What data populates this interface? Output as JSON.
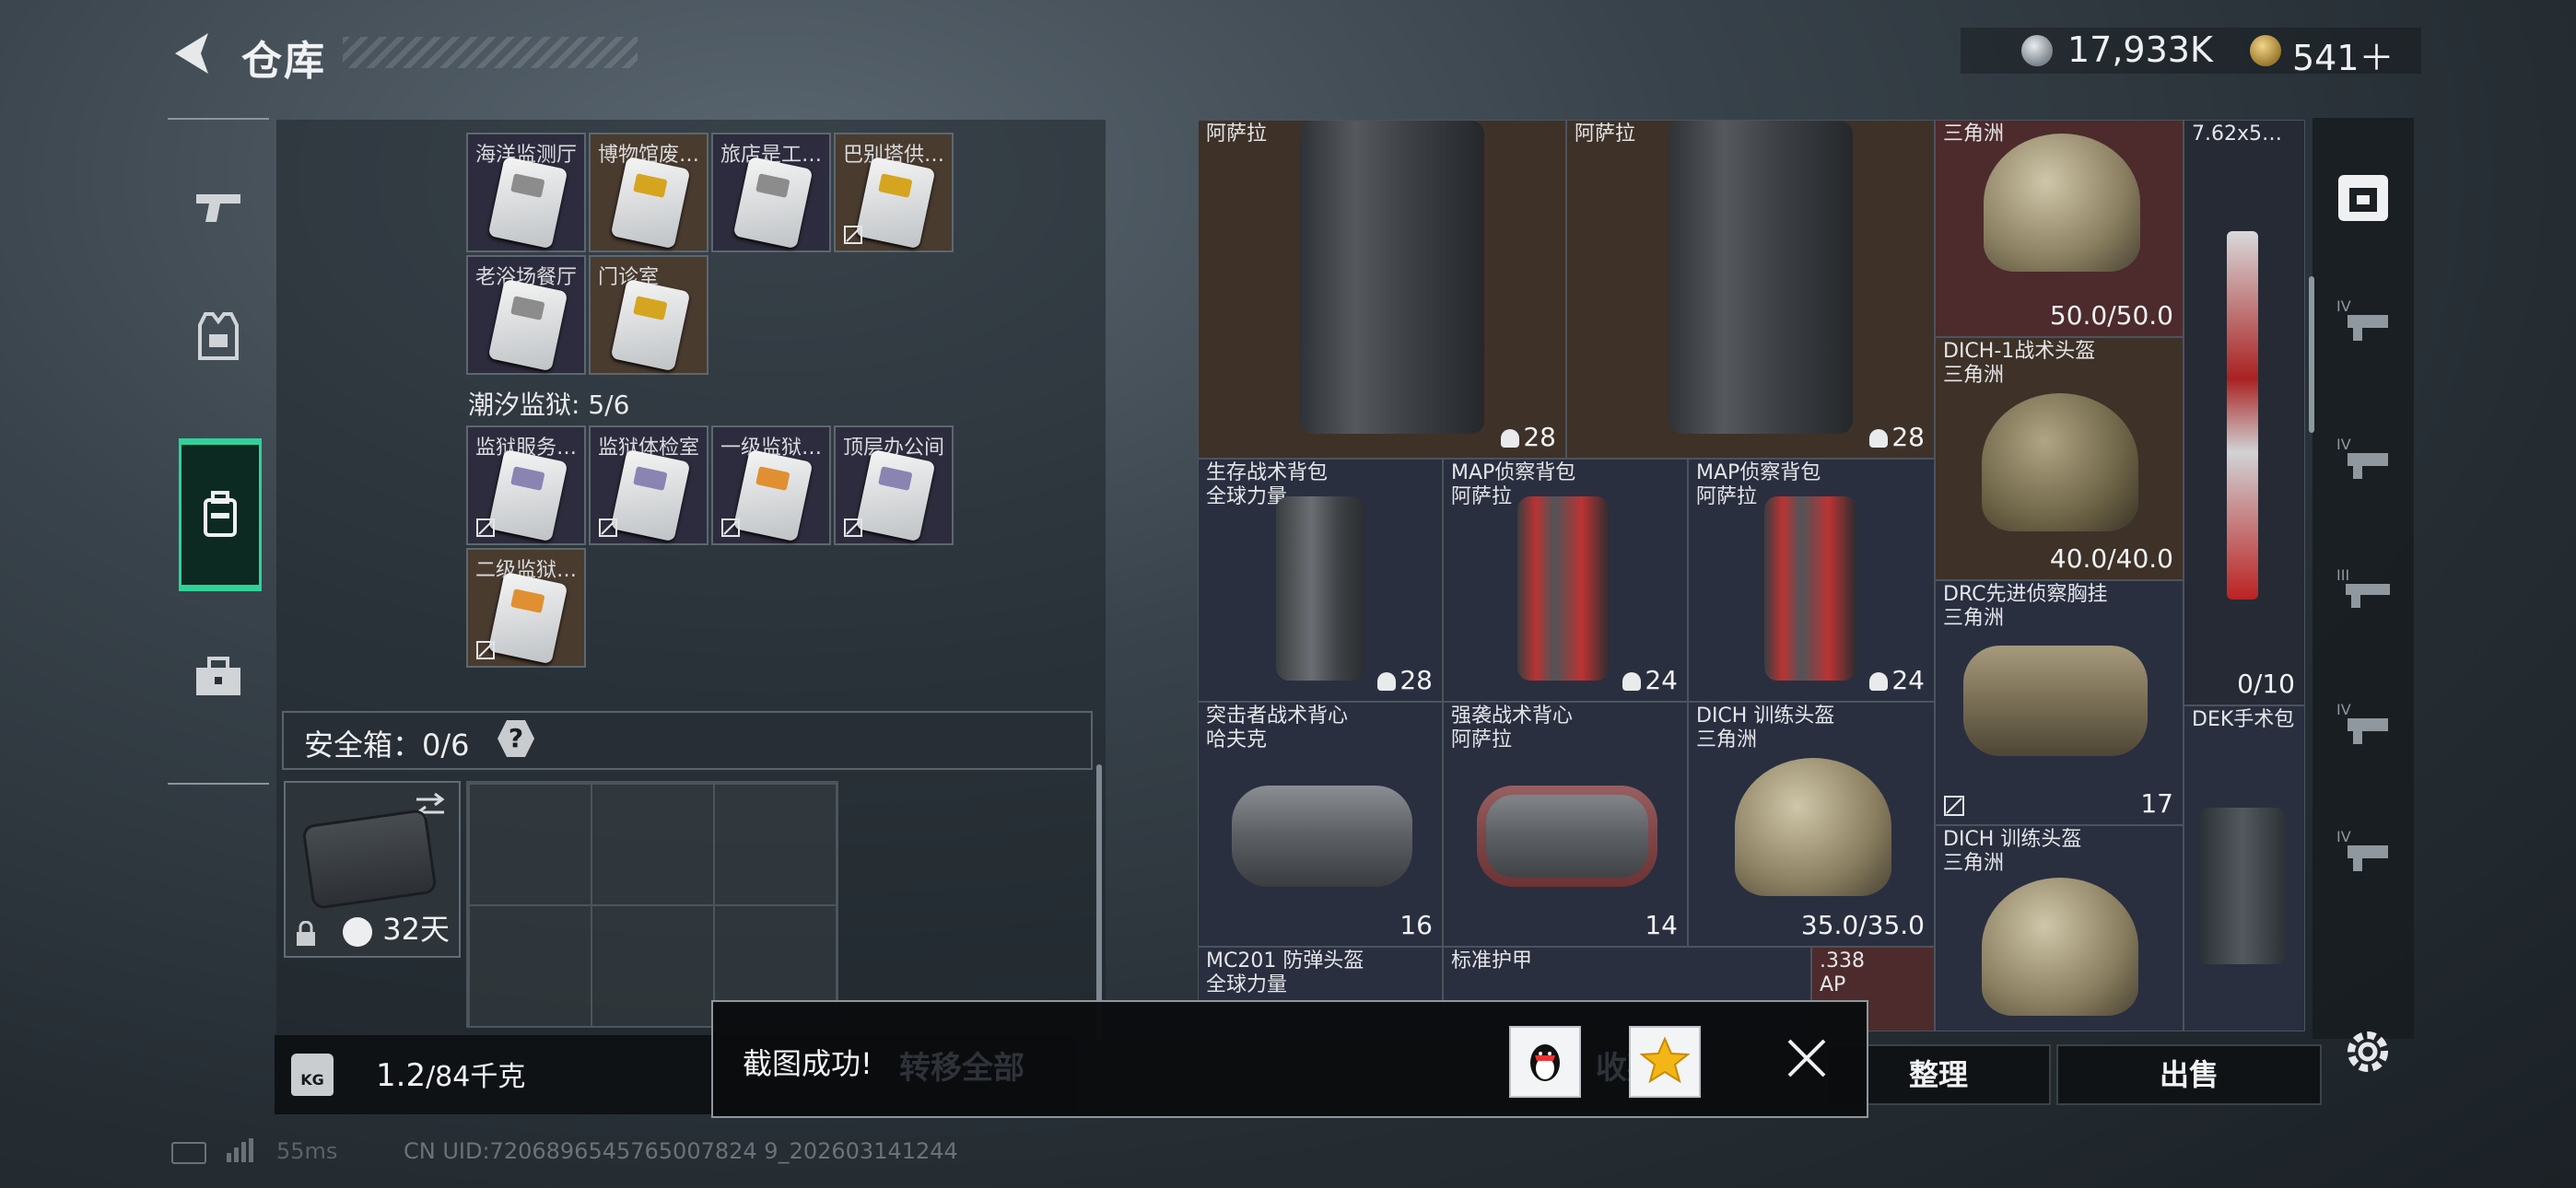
{
  "header": {
    "title": "仓库",
    "silver": "17,933K",
    "gold": "541＋"
  },
  "left_nav": [
    {
      "icon": "pistol-icon"
    },
    {
      "icon": "vest-icon"
    },
    {
      "icon": "backpack-icon"
    },
    {
      "icon": "toolbox-icon"
    }
  ],
  "keycards_top": [
    {
      "label": "海洋监测厅",
      "card": "kc-plain",
      "locked": false,
      "tone": "violet"
    },
    {
      "label": "博物馆废…",
      "card": "kc-gold",
      "locked": false,
      "tone": "orange"
    },
    {
      "label": "旅店是工…",
      "card": "kc-plain",
      "locked": false,
      "tone": "violet"
    },
    {
      "label": "巴别塔供…",
      "card": "kc-gold",
      "locked": true,
      "tone": "orange"
    },
    {
      "label": "老浴场餐厅",
      "card": "kc-plain",
      "locked": false,
      "tone": "violet"
    },
    {
      "label": "门诊室",
      "card": "kc-gold",
      "locked": false,
      "tone": "orange"
    }
  ],
  "tidal": {
    "label": "潮汐监狱: 5/6"
  },
  "keycards_tidal": [
    {
      "label": "监狱服务…",
      "card": "kc-violet",
      "locked": true,
      "tone": "violet"
    },
    {
      "label": "监狱体检室",
      "card": "kc-violet",
      "locked": true,
      "tone": "violet"
    },
    {
      "label": "一级监狱…",
      "card": "kc-orange",
      "locked": true,
      "tone": "violet"
    },
    {
      "label": "顶层办公间",
      "card": "kc-violet",
      "locked": true,
      "tone": "violet"
    },
    {
      "label": "二级监狱…",
      "card": "kc-orange",
      "locked": true,
      "tone": "orange"
    }
  ],
  "safe_box": {
    "label": "安全箱：0/6",
    "help": "?",
    "days": "32天"
  },
  "weight": {
    "current": "1.2",
    "max": "/84千克"
  },
  "inventory": {
    "vest1": {
      "name": "阿萨拉",
      "count": "28"
    },
    "vest2": {
      "name": "阿萨拉",
      "count": "28"
    },
    "helmet1": {
      "name": "三角洲",
      "durability": "50.0/50.0"
    },
    "rifle": {
      "name": "7.62x5…",
      "count": "0/10"
    },
    "helmet2": {
      "name": "DICH-1战术头盔",
      "sub": "三角洲",
      "durability": "40.0/40.0"
    },
    "pack1": {
      "name": "生存战术背包",
      "sub": "全球力量",
      "count": "28"
    },
    "pack2": {
      "name": "MAP侦察背包",
      "sub": "阿萨拉",
      "count": "24"
    },
    "pack3": {
      "name": "MAP侦察背包",
      "sub": "阿萨拉",
      "count": "24"
    },
    "rig1": {
      "name": "DRC先进侦察胸挂",
      "sub": "三角洲",
      "count": "17"
    },
    "rig2": {
      "name": "突击者战术背心",
      "sub": "哈夫克",
      "count": "16"
    },
    "rig3": {
      "name": "强袭战术背心",
      "sub": "阿萨拉",
      "count": "14"
    },
    "helmet3": {
      "name": "DICH 训练头盔",
      "sub": "三角洲",
      "durability": "35.0/35.0"
    },
    "medkit": {
      "name": "DEK手术包"
    },
    "helmet4": {
      "name": "DICH 训练头盔",
      "sub": "三角洲"
    },
    "helmet5": {
      "name": "MC201 防弹头盔",
      "sub": "全球力量"
    },
    "armor": {
      "name": "标准护甲"
    },
    "ammo": {
      "name": ".338",
      "sub": "AP"
    }
  },
  "right_nav": [
    {
      "icon": "safe-icon"
    },
    {
      "icon": "gun-lvl4-icon"
    },
    {
      "icon": "gun-lvl4-icon"
    },
    {
      "icon": "gun-lvl3-icon"
    },
    {
      "icon": "gun-lvl4-icon"
    },
    {
      "icon": "gun-lvl4-icon"
    }
  ],
  "buttons": {
    "sort": "整理",
    "sell": "出售"
  },
  "toast": {
    "text": "截图成功!",
    "behind_left": "转移全部",
    "behind_right": "收藏"
  },
  "status": {
    "ping": "55ms",
    "uid": "CN UID:7206896545765007824 9_202603141244"
  }
}
